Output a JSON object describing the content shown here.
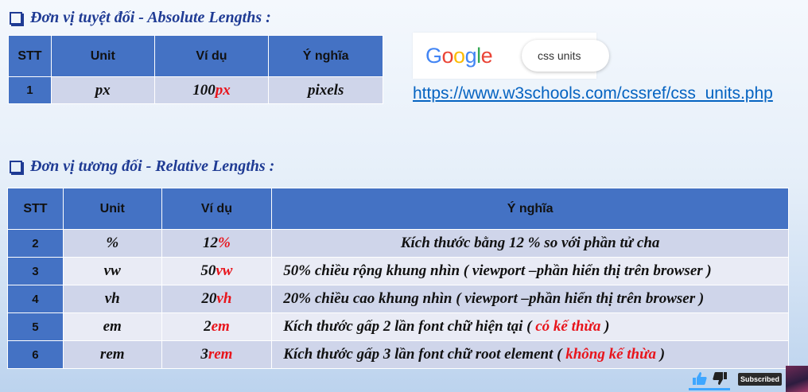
{
  "section1": {
    "heading": "Đơn vị tuyệt đối - Absolute Lengths :",
    "headers": [
      "STT",
      "Unit",
      "Ví dụ",
      "Ý nghĩa"
    ],
    "rows": [
      {
        "stt": "1",
        "unit": "px",
        "example_num": "100",
        "example_unit": "px",
        "meaning": "pixels"
      }
    ]
  },
  "google": {
    "logo_letters": [
      {
        "ch": "G",
        "color": "#4285f4"
      },
      {
        "ch": "o",
        "color": "#ea4335"
      },
      {
        "ch": "o",
        "color": "#fbbc05"
      },
      {
        "ch": "g",
        "color": "#4285f4"
      },
      {
        "ch": "l",
        "color": "#34a853"
      },
      {
        "ch": "e",
        "color": "#ea4335"
      }
    ],
    "search_text": "css units"
  },
  "link": "https://www.w3schools.com/cssref/css_units.php",
  "section2": {
    "heading": "Đơn vị tương đối - Relative Lengths :",
    "headers": [
      "STT",
      "Unit",
      "Ví dụ",
      "Ý nghĩa"
    ],
    "rows": [
      {
        "stt": "2",
        "unit": "%",
        "example_num": "12",
        "example_unit": "%",
        "meaning_pre": "Kích thước bằng 12 % so với phần tử cha",
        "meaning_red": "",
        "meaning_post": "",
        "align": "center"
      },
      {
        "stt": "3",
        "unit": "vw",
        "example_num": "50",
        "example_unit": "vw",
        "meaning_pre": "50% chiều rộng khung nhìn ( viewport –phần hiển thị trên browser )",
        "meaning_red": "",
        "meaning_post": "",
        "align": "left"
      },
      {
        "stt": "4",
        "unit": "vh",
        "example_num": "20",
        "example_unit": "vh",
        "meaning_pre": "20% chiều cao khung nhìn ( viewport –phần hiển thị trên browser )",
        "meaning_red": "",
        "meaning_post": "",
        "align": "left"
      },
      {
        "stt": "5",
        "unit": "em",
        "example_num": "2",
        "example_unit": "em",
        "meaning_pre": "Kích thước gấp 2 lần font chữ hiện tại ( ",
        "meaning_red": "có kế thừa",
        "meaning_post": " )",
        "align": "left"
      },
      {
        "stt": "6",
        "unit": "rem",
        "example_num": "3",
        "example_unit": "rem",
        "meaning_pre": "Kích thước gấp 3 lần font chữ root element ( ",
        "meaning_red": "không kế thừa",
        "meaning_post": " )",
        "align": "left"
      }
    ]
  },
  "youtube": {
    "like_icon": "thumbs-up-icon",
    "dislike_icon": "thumbs-down-icon",
    "subscribed_label": "Subscribed"
  },
  "colors": {
    "header_blue": "#4472c4",
    "red_text": "#e8141b",
    "heading_blue": "#1f3b94",
    "link_blue": "#0563c1"
  }
}
